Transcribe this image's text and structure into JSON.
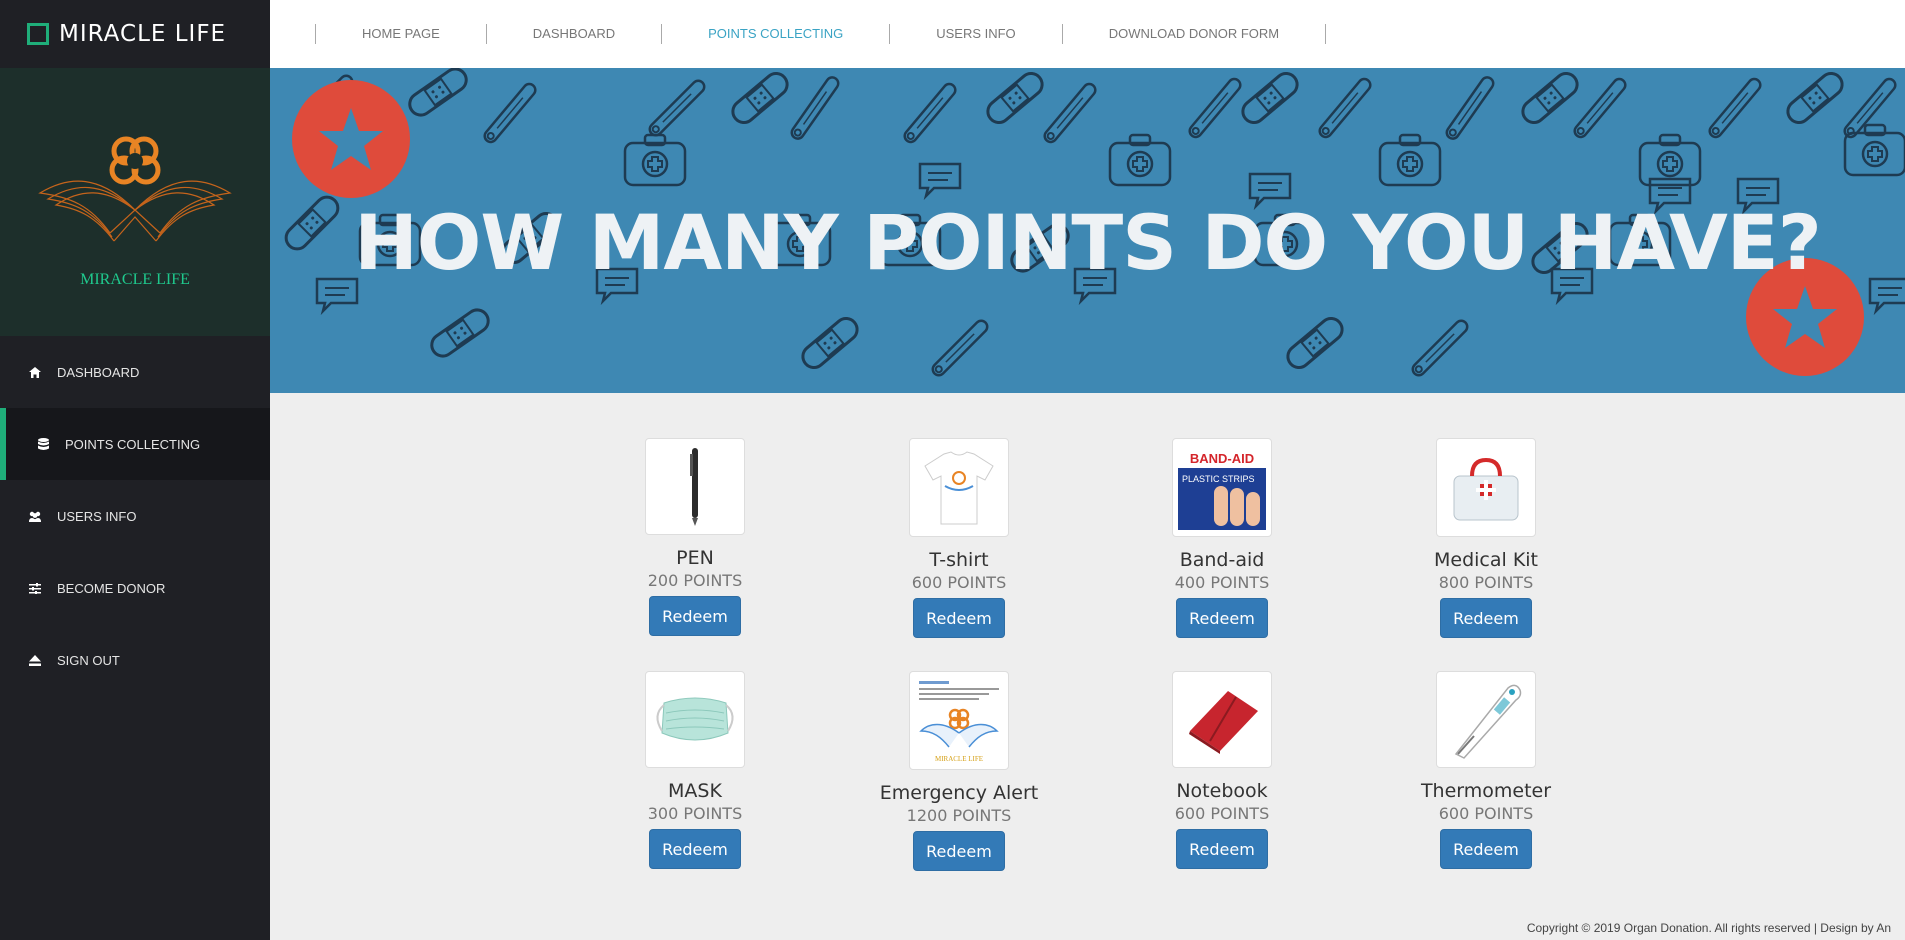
{
  "brand": {
    "name": "MIRACLE LIFE",
    "logo_caption": "MIRACLE LIFE"
  },
  "sidebar": {
    "items": [
      {
        "label": "DASHBOARD",
        "icon": "home-icon"
      },
      {
        "label": "POINTS COLLECTING",
        "icon": "database-icon",
        "active": true
      },
      {
        "label": "USERS INFO",
        "icon": "users-icon"
      },
      {
        "label": "BECOME DONOR",
        "icon": "sliders-icon"
      },
      {
        "label": "SIGN OUT",
        "icon": "eject-icon"
      }
    ]
  },
  "topnav": {
    "items": [
      {
        "label": "HOME PAGE"
      },
      {
        "label": "DASHBOARD"
      },
      {
        "label": "POINTS COLLECTING",
        "active": true
      },
      {
        "label": "USERS INFO"
      },
      {
        "label": "DOWNLOAD DONOR FORM"
      }
    ]
  },
  "banner": {
    "title": "HOW MANY POINTS DO YOU HAVE?"
  },
  "products": [
    {
      "name": "PEN",
      "points": "200 POINTS",
      "icon": "pen-image"
    },
    {
      "name": "T-shirt",
      "points": "600 POINTS",
      "icon": "tshirt-image"
    },
    {
      "name": "Band-aid",
      "points": "400 POINTS",
      "icon": "bandaid-image",
      "box_label": "BAND-AID",
      "box_sub": "PLASTIC STRIPS"
    },
    {
      "name": "Medical Kit",
      "points": "800 POINTS",
      "icon": "medical-kit-image"
    },
    {
      "name": "MASK",
      "points": "300 POINTS",
      "icon": "mask-image"
    },
    {
      "name": "Emergency Alert",
      "points": "1200 POINTS",
      "icon": "emergency-alert-image",
      "card_caption": "MIRACLE LIFE"
    },
    {
      "name": "Notebook",
      "points": "600 POINTS",
      "icon": "notebook-image"
    },
    {
      "name": "Thermometer",
      "points": "600 POINTS",
      "icon": "thermometer-image"
    }
  ],
  "redeem_label": "Redeem",
  "footer": {
    "text": "Copyright © 2019 Organ Donation. All rights reserved | Design by An"
  },
  "colors": {
    "accent": "#1fae7a",
    "banner": "#3e88b3",
    "badge": "#df4b3b",
    "button": "#337ab7",
    "nav_active": "#3aa3c4"
  }
}
